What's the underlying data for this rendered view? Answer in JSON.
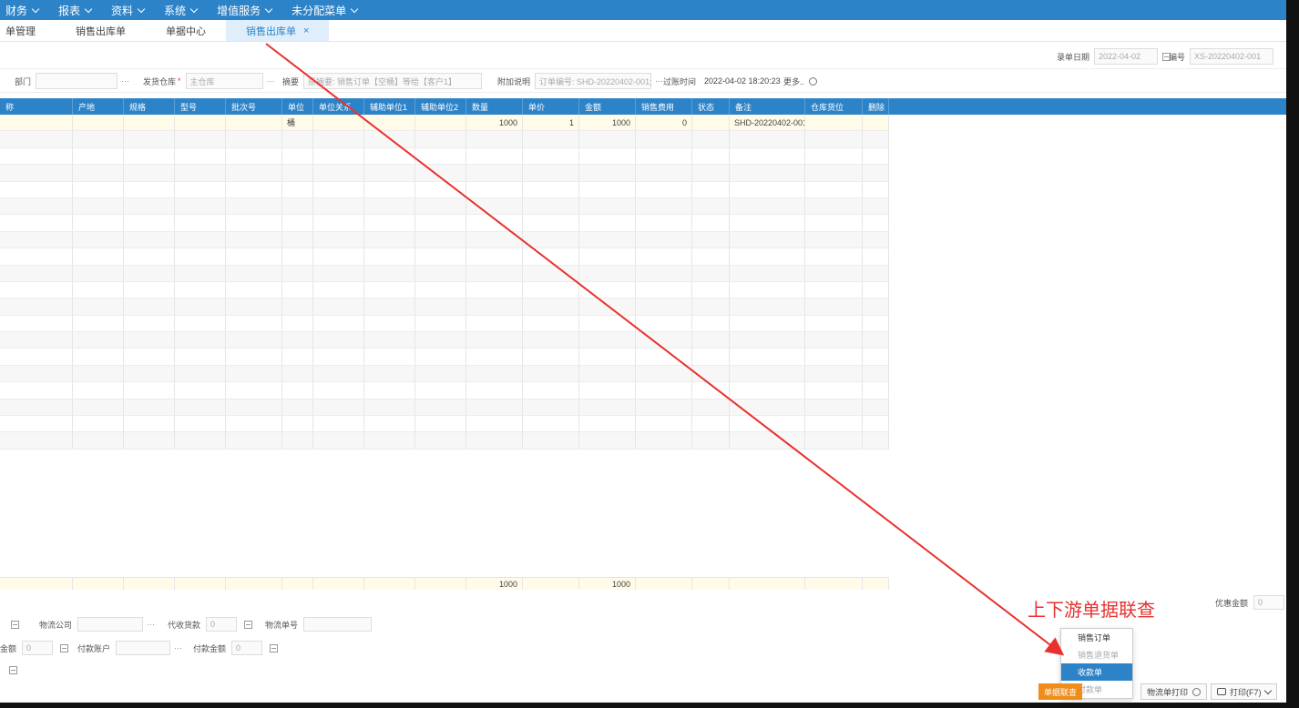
{
  "topmenu": [
    "财务",
    "报表",
    "资料",
    "系统",
    "增值服务",
    "未分配菜单"
  ],
  "tabs": [
    {
      "label": "单管理",
      "active": false,
      "closable": false
    },
    {
      "label": "销售出库单",
      "active": false,
      "closable": false
    },
    {
      "label": "单据中心",
      "active": false,
      "closable": false
    },
    {
      "label": "销售出库单",
      "active": true,
      "closable": true
    }
  ],
  "tab_close_glyph": "×",
  "header_row1": {
    "date_label": "录单日期",
    "date_value": "2022-04-02",
    "number_label": "编号",
    "number_value": "XS-20220402-001"
  },
  "header_row2": {
    "dept_label": "部门",
    "dept_value": "",
    "warehouse_label": "发货仓库",
    "warehouse_value": "主仓库",
    "summary_label": "摘要",
    "summary_value": "原摘要: 销售订单【空桶】等给【客户1】",
    "extra_label": "附加说明",
    "extra_value": "订单编号: SHD-20220402-001;",
    "posting_label": "过账时间",
    "posting_value": "2022-04-02 18:20:23",
    "more_label": "更多.."
  },
  "grid": {
    "columns": [
      "称",
      "产地",
      "规格",
      "型号",
      "批次号",
      "单位",
      "单位关系",
      "辅助单位1",
      "辅助单位2",
      "数量",
      "单价",
      "金额",
      "销售费用",
      "状态",
      "备注",
      "仓库货位",
      "删除"
    ],
    "first_row": [
      "",
      "",
      "",
      "",
      "",
      "桶",
      "",
      "",
      "",
      "1000",
      "1",
      "1000",
      "0",
      "",
      "SHD-20220402-001;",
      "",
      ""
    ],
    "totals": {
      "qty": "1000",
      "amount": "1000"
    }
  },
  "bottom": {
    "logistics_company_label": "物流公司",
    "collect_label": "代收货款",
    "collect_value": "0",
    "tracking_label": "物流单号",
    "amount_label": "金额",
    "amount_value": "0",
    "pay_account_label": "付款账户",
    "pay_amount_label": "付款金额",
    "pay_amount_value": "0",
    "discount_label": "优惠金额",
    "discount_value": "0"
  },
  "annotation": "上下游单据联查",
  "dropdown": [
    {
      "label": "销售订单",
      "state": "normal"
    },
    {
      "label": "销售退货单",
      "state": "dim"
    },
    {
      "label": "收款单",
      "state": "selected"
    },
    {
      "label": "付款单",
      "state": "dim"
    }
  ],
  "footer": {
    "linked_btn": "单据联查",
    "logistics_print": "物流单打印",
    "print": "打印(F7)"
  },
  "colors": {
    "primary": "#2d83c8",
    "accent_orange": "#f08c1a",
    "annotation_red": "#e8312f"
  }
}
